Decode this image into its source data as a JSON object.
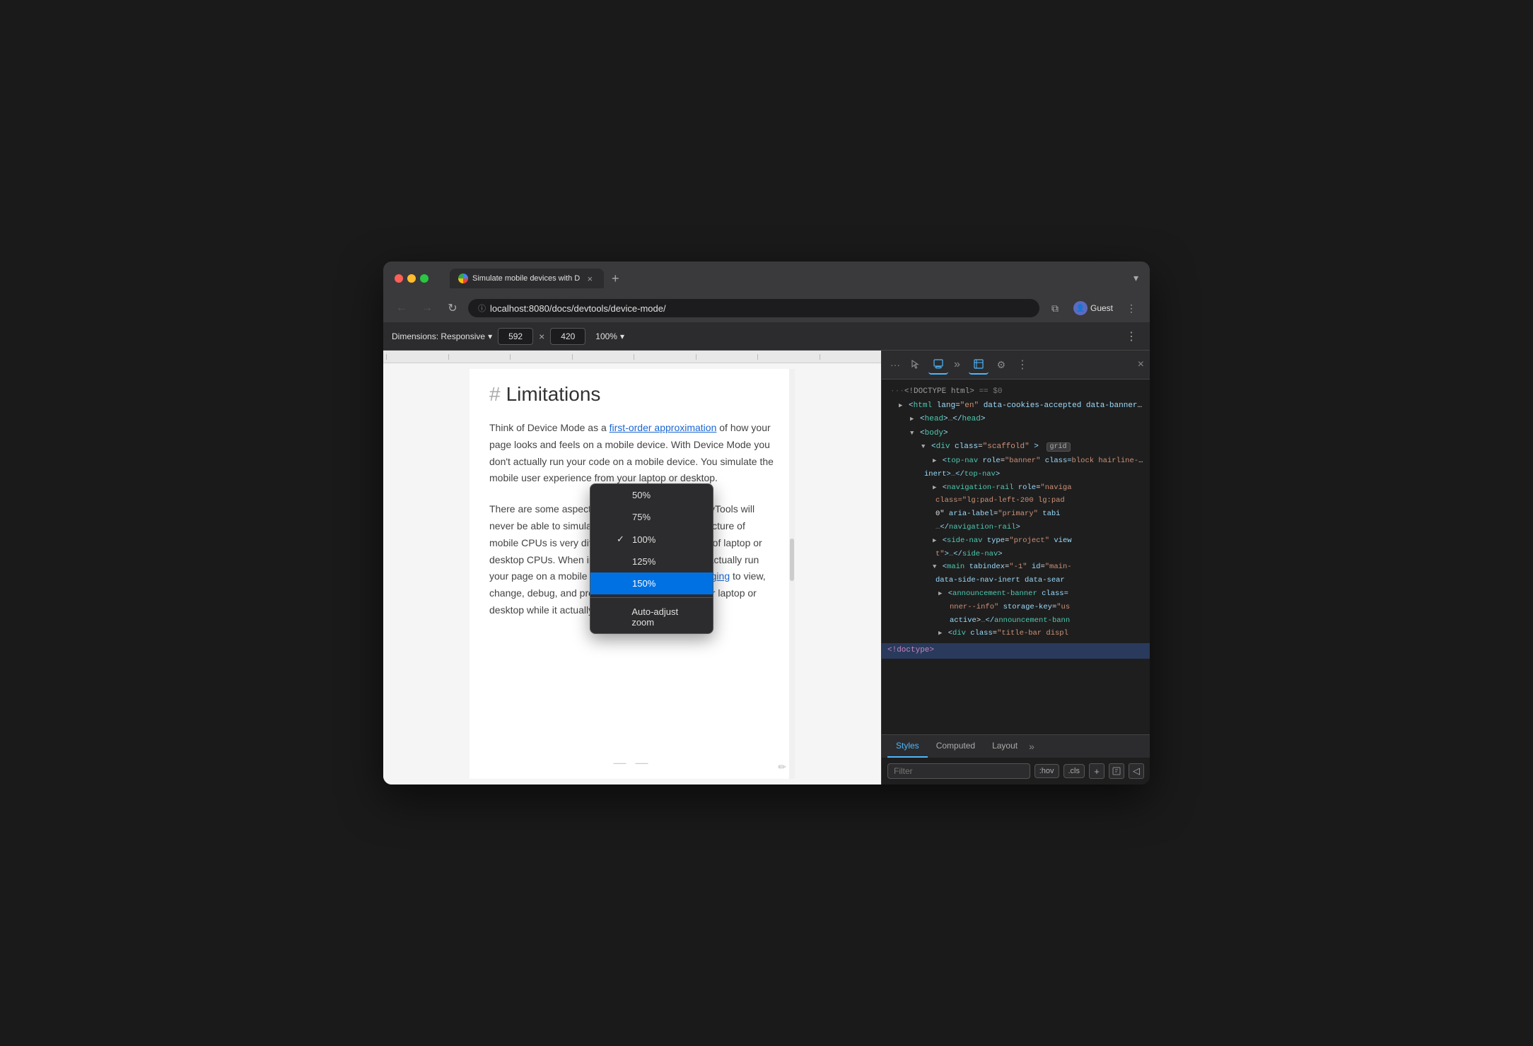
{
  "window": {
    "title": "Simulate mobile devices with D"
  },
  "tab": {
    "title": "Simulate mobile devices with D",
    "close_label": "×"
  },
  "new_tab_label": "+",
  "nav": {
    "back_label": "←",
    "forward_label": "→",
    "refresh_label": "↻",
    "url": "localhost:8080/docs/devtools/device-mode/",
    "profile_label": "Guest"
  },
  "device_toolbar": {
    "dimensions_label": "Dimensions: Responsive",
    "width": "592",
    "height": "420",
    "zoom_label": "100%",
    "more_label": "⋮"
  },
  "zoom_dropdown": {
    "options": [
      {
        "label": "50%",
        "selected": false,
        "checked": false
      },
      {
        "label": "75%",
        "selected": false,
        "checked": false
      },
      {
        "label": "100%",
        "selected": false,
        "checked": true
      },
      {
        "label": "125%",
        "selected": false,
        "checked": false
      },
      {
        "label": "150%",
        "selected": true,
        "checked": false
      }
    ],
    "auto_label": "Auto-adjust zoom"
  },
  "page": {
    "heading": "Limitations",
    "para1": "Think of Device Mode as a first-order approximation of how your page looks and feels on a mobile device. With Device Mode you don't actually run your code on a mobile device. You simulate the mobile user experience from your laptop or desktop.",
    "para1_link": "first-order approximation",
    "para2_before": "There are some aspects of mobile devices that DevTools will never be able to simulate. For example, the architecture of mobile CPUs is very different than the architecture of laptop or desktop CPUs. When in doubt, your best bet is to actually run your page on a mobile device. Use",
    "para2_link": "Remote Debugging",
    "para2_after": "to view, change, debug, and profile a page's code from your laptop or desktop while it actually runs on a mobile device."
  },
  "devtools": {
    "toolbar_dots": "···",
    "tools": [
      {
        "label": "🖱",
        "name": "pointer-tool"
      },
      {
        "label": "📱",
        "name": "device-tool",
        "active": true
      }
    ],
    "more_label": "»",
    "panel_icon": "≡",
    "settings_icon": "⚙",
    "more2_label": "⋮",
    "close_label": "×",
    "html_lines": [
      {
        "indent": 0,
        "text": "···<!DOCTYPE html> == $0",
        "class": "top-comment"
      },
      {
        "indent": 1,
        "text": "<html lang=\"en\" data-cookies-accepted data-banner-dismissed>",
        "class": ""
      },
      {
        "indent": 2,
        "text": "▶ <head>…</head>",
        "class": ""
      },
      {
        "indent": 2,
        "text": "▼ <body>",
        "class": ""
      },
      {
        "indent": 3,
        "text": "▼ <div class=\"scaffold\"> grid",
        "class": ""
      },
      {
        "indent": 4,
        "text": "▶ <top-nav role=\"banner\" class=block hairline-bottom\" data-s inert>…</top-nav>",
        "class": ""
      },
      {
        "indent": 4,
        "text": "▶ <navigation-rail role=\"naviga class=\"lg:pad-left-200 lg:pad 0\" aria-label=\"primary\" tabi …</navigation-rail>",
        "class": ""
      },
      {
        "indent": 4,
        "text": "▶ <side-nav type=\"project\" view t\">…</side-nav>",
        "class": ""
      },
      {
        "indent": 4,
        "text": "▼ <main tabindex=\"-1\" id=\"main- data-side-nav-inert data-sear",
        "class": ""
      },
      {
        "indent": 5,
        "text": "▶ <announcement-banner class= nner--info\" storage-key=\"us active>…</announcement-bann",
        "class": ""
      },
      {
        "indent": 5,
        "text": "▶ <div class=\"title-bar displ",
        "class": ""
      }
    ],
    "doctype_line": "<!doctype>",
    "tabs": [
      {
        "label": "Styles",
        "active": true
      },
      {
        "label": "Computed",
        "active": false
      },
      {
        "label": "Layout",
        "active": false
      }
    ],
    "tabs_more": "»",
    "styles_filter_placeholder": "Filter",
    "styles_hov": ":hov",
    "styles_cls": ".cls",
    "styles_plus": "+",
    "styles_computed_label": "Computed"
  }
}
